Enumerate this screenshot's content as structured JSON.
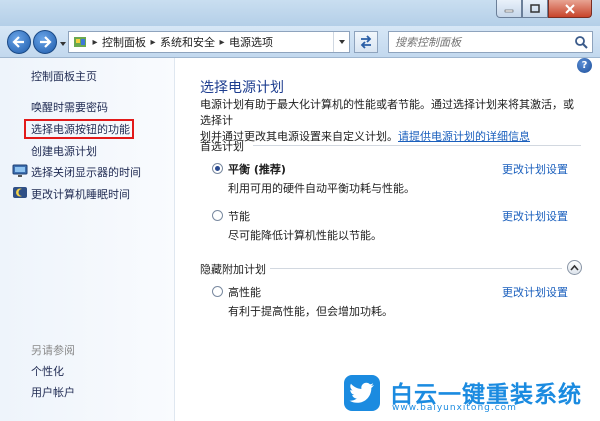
{
  "address_bar": {
    "breadcrumbs": [
      "控制面板",
      "系统和安全",
      "电源选项"
    ],
    "search_placeholder": "搜索控制面板"
  },
  "sidebar": {
    "home": "控制面板主页",
    "links": [
      {
        "label": "唤醒时需要密码",
        "icon": null
      },
      {
        "label": "选择电源按钮的功能",
        "icon": null,
        "highlighted": true
      },
      {
        "label": "创建电源计划",
        "icon": null
      },
      {
        "label": "选择关闭显示器的时间",
        "icon": "monitor-icon"
      },
      {
        "label": "更改计算机睡眠时间",
        "icon": "moon-icon"
      }
    ],
    "see_also": "另请参阅",
    "see_also_links": [
      "个性化",
      "用户帐户"
    ],
    "highlight_color": "#e21a1a"
  },
  "main": {
    "title": "选择电源计划",
    "description_line1": "电源计划有助于最大化计算机的性能或者节能。通过选择计划来将其激活，或选择计",
    "description_line2": "划并通过更改其电源设置来自定义计划。",
    "description_link": "请提供电源计划的详细信息",
    "preferred_header": "首选计划",
    "hidden_header": "隐藏附加计划",
    "plans": [
      {
        "name": "平衡 (推荐)",
        "desc": "利用可用的硬件自动平衡功耗与性能。",
        "selected": true,
        "change": "更改计划设置"
      },
      {
        "name": "节能",
        "desc": "尽可能降低计算机性能以节能。",
        "selected": false,
        "change": "更改计划设置"
      },
      {
        "name": "高性能",
        "desc": "有利于提高性能，但会增加功耗。",
        "selected": false,
        "change": "更改计划设置"
      }
    ]
  },
  "watermark": {
    "title": "白云一键重装系统",
    "url": "www.baiyunxitong.com",
    "color": "#1b8be0"
  }
}
